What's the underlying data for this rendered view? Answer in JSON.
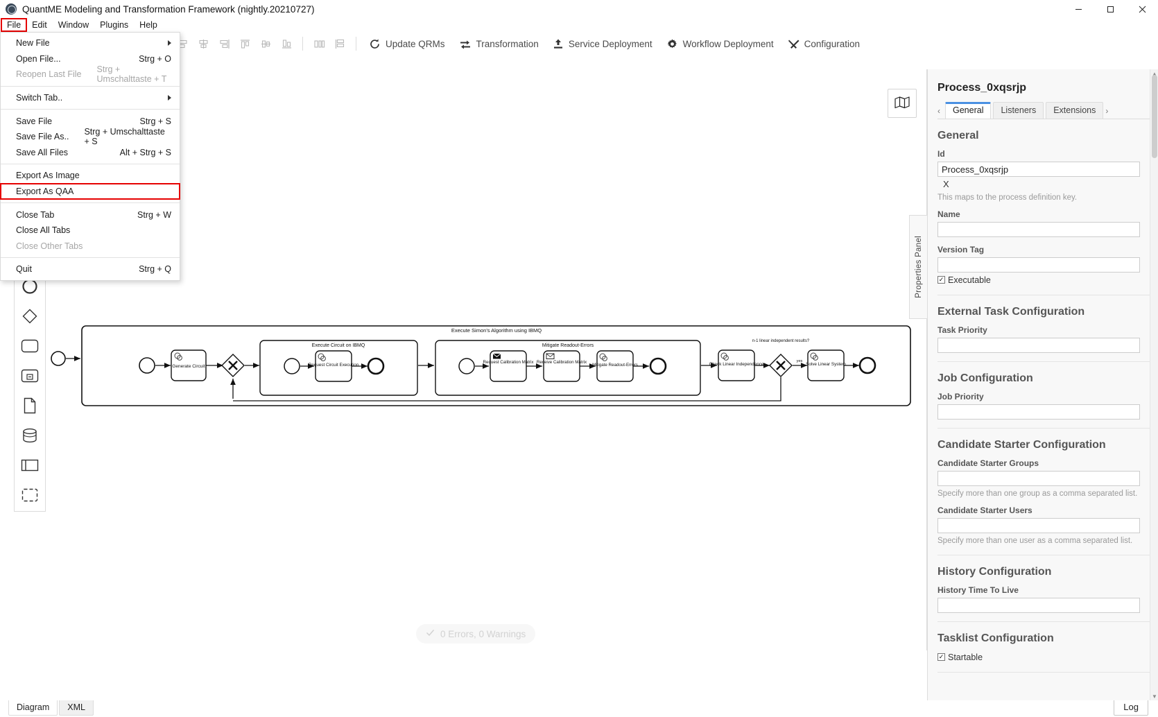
{
  "window": {
    "title": "QuantME Modeling and Transformation Framework (nightly.20210727)",
    "app_icon": "quantme-logo-icon",
    "minimize": "—",
    "maximize": "☐",
    "close": "✕"
  },
  "menubar": {
    "items": [
      {
        "label": "File",
        "open": true
      },
      {
        "label": "Edit",
        "open": false
      },
      {
        "label": "Window",
        "open": false
      },
      {
        "label": "Plugins",
        "open": false
      },
      {
        "label": "Help",
        "open": false
      }
    ]
  },
  "file_menu": {
    "items": [
      {
        "label": "New File",
        "accel": "",
        "submenu": true,
        "disabled": false,
        "highlight": false
      },
      {
        "label": "Open File...",
        "accel": "Strg + O",
        "submenu": false,
        "disabled": false,
        "highlight": false
      },
      {
        "label": "Reopen Last File",
        "accel": "Strg + Umschalttaste + T",
        "submenu": false,
        "disabled": true,
        "highlight": false
      },
      {
        "separator": true
      },
      {
        "label": "Switch Tab..",
        "accel": "",
        "submenu": true,
        "disabled": false,
        "highlight": false
      },
      {
        "separator": true
      },
      {
        "label": "Save File",
        "accel": "Strg + S",
        "submenu": false,
        "disabled": false,
        "highlight": false
      },
      {
        "label": "Save File As..",
        "accel": "Strg + Umschalttaste + S",
        "submenu": false,
        "disabled": false,
        "highlight": false
      },
      {
        "label": "Save All Files",
        "accel": "Alt + Strg + S",
        "submenu": false,
        "disabled": false,
        "highlight": false
      },
      {
        "separator": true
      },
      {
        "label": "Export As Image",
        "accel": "",
        "submenu": false,
        "disabled": false,
        "highlight": false
      },
      {
        "label": "Export As QAA",
        "accel": "",
        "submenu": false,
        "disabled": false,
        "highlight": true
      },
      {
        "separator": true
      },
      {
        "label": "Close Tab",
        "accel": "Strg + W",
        "submenu": false,
        "disabled": false,
        "highlight": false
      },
      {
        "label": "Close All Tabs",
        "accel": "",
        "submenu": false,
        "disabled": false,
        "highlight": false
      },
      {
        "label": "Close Other Tabs",
        "accel": "",
        "submenu": false,
        "disabled": true,
        "highlight": false
      },
      {
        "separator": true
      },
      {
        "label": "Quit",
        "accel": "Strg + Q",
        "submenu": false,
        "disabled": false,
        "highlight": false
      }
    ]
  },
  "toolbar": {
    "icon_buttons": [
      "align-left-icon",
      "align-center-icon",
      "align-right-icon",
      "align-top-icon",
      "align-middle-icon",
      "align-bottom-icon",
      "distribute-horizontal-icon",
      "distribute-vertical-icon"
    ],
    "buttons": [
      {
        "label": "Update QRMs",
        "icon": "refresh-icon"
      },
      {
        "label": "Transformation",
        "icon": "transform-icon"
      },
      {
        "label": "Service Deployment",
        "icon": "upload-icon"
      },
      {
        "label": "Workflow Deployment",
        "icon": "gear-icon"
      },
      {
        "label": "Configuration",
        "icon": "tools-icon"
      }
    ]
  },
  "palette": {
    "items": [
      {
        "name": "start-event-tool",
        "icon": "circle-icon"
      },
      {
        "name": "gateway-tool",
        "icon": "diamond-icon"
      },
      {
        "name": "task-tool",
        "icon": "rounded-rect-icon"
      },
      {
        "name": "subprocess-tool",
        "icon": "collapsed-subprocess-icon"
      },
      {
        "name": "data-object-tool",
        "icon": "document-icon"
      },
      {
        "name": "data-store-tool",
        "icon": "database-icon"
      },
      {
        "name": "participant-tool",
        "icon": "pool-icon"
      },
      {
        "name": "group-tool",
        "icon": "dashed-group-icon"
      }
    ]
  },
  "canvas": {
    "minimap_icon": "map-icon",
    "status": {
      "check_icon": "check-icon",
      "text": "0 Errors, 0 Warnings"
    },
    "diagram": {
      "pool_label": "Execute Simon's Algorithm using IBMQ",
      "subprocess_1_label": "Execute Circuit on IBMQ",
      "subprocess_2_label": "Mitigate Readout-Errors",
      "tasks": [
        "Generate Circuit",
        "Request Circuit Execution",
        "Request Calibration Matrix",
        "Receive Calibration Matrix",
        "Mitigate Readout-Errors",
        "Check Linear Independence",
        "Solve Linear System"
      ],
      "gateway_label": "n-1 linear independent results?",
      "flow_label_yes": "yes"
    }
  },
  "properties": {
    "title": "Process_0xqsrjp",
    "tab_prev_arrow": "‹",
    "tab_next_arrow": "›",
    "tabs": [
      {
        "label": "General",
        "active": true
      },
      {
        "label": "Listeners",
        "active": false
      },
      {
        "label": "Extensions",
        "active": false
      }
    ],
    "handle_label": "Properties Panel",
    "sections": [
      {
        "heading": "General",
        "fields": [
          {
            "label": "Id",
            "value": "Process_0xqsrjp",
            "clear": "X",
            "hint": "This maps to the process definition key.",
            "type": "text"
          },
          {
            "label": "Name",
            "value": "",
            "type": "textarea"
          },
          {
            "label": "Version Tag",
            "value": "",
            "type": "text"
          }
        ],
        "checkbox": {
          "label": "Executable",
          "checked": true
        }
      },
      {
        "heading": "External Task Configuration",
        "fields": [
          {
            "label": "Task Priority",
            "value": "",
            "type": "text"
          }
        ]
      },
      {
        "heading": "Job Configuration",
        "fields": [
          {
            "label": "Job Priority",
            "value": "",
            "type": "text"
          }
        ]
      },
      {
        "heading": "Candidate Starter Configuration",
        "fields": [
          {
            "label": "Candidate Starter Groups",
            "value": "",
            "hint": "Specify more than one group as a comma separated list.",
            "type": "text"
          },
          {
            "label": "Candidate Starter Users",
            "value": "",
            "hint": "Specify more than one user as a comma separated list.",
            "type": "text"
          }
        ]
      },
      {
        "heading": "History Configuration",
        "fields": [
          {
            "label": "History Time To Live",
            "value": "",
            "type": "text"
          }
        ]
      },
      {
        "heading": "Tasklist Configuration",
        "fields": [],
        "checkbox": {
          "label": "Startable",
          "checked": true
        }
      }
    ]
  },
  "bottom": {
    "tabs": [
      {
        "label": "Diagram",
        "active": true
      },
      {
        "label": "XML",
        "active": false
      }
    ],
    "log_button": "Log"
  },
  "colors": {
    "accent_tab": "#4a90e2",
    "highlight_outline": "#e60000",
    "panel_bg": "#f8f8f8",
    "text": "#222222"
  }
}
